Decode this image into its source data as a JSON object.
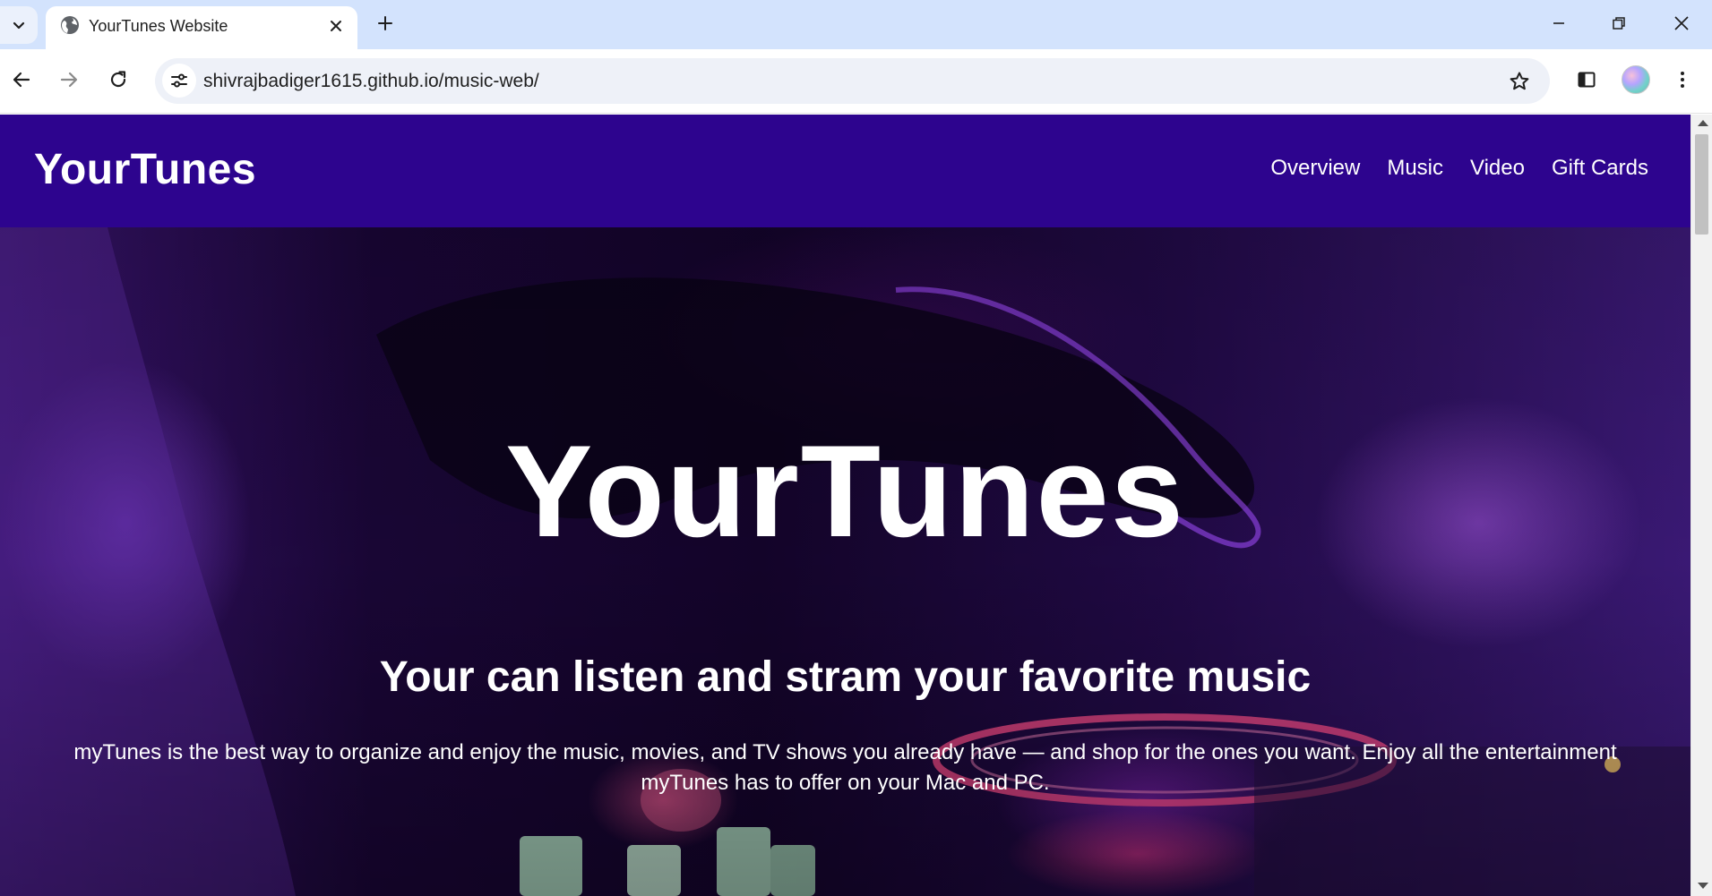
{
  "browser": {
    "tab_title": "YourTunes Website",
    "url": "shivrajbadiger1615.github.io/music-web/"
  },
  "site": {
    "brand": "YourTunes",
    "nav": [
      {
        "label": "Overview"
      },
      {
        "label": "Music"
      },
      {
        "label": "Video"
      },
      {
        "label": "Gift Cards"
      }
    ],
    "header_color": "#2d048e"
  },
  "hero": {
    "title": "YourTunes",
    "subtitle": "Your can listen and stram your favorite music",
    "description": "myTunes is the best way to organize and enjoy the music, movies, and TV shows you already have — and shop for the ones you want. Enjoy all the entertainment myTunes has to offer on your Mac and PC."
  },
  "icons": {
    "tab_search": "chevron-down-icon",
    "favicon": "globe-icon",
    "close": "close-icon",
    "new_tab": "plus-icon",
    "back": "arrow-left-icon",
    "forward": "arrow-right-icon",
    "reload": "reload-icon",
    "site_info": "tune-icon",
    "bookmark": "star-icon",
    "side_panel": "side-panel-icon",
    "menu": "kebab-menu-icon"
  }
}
